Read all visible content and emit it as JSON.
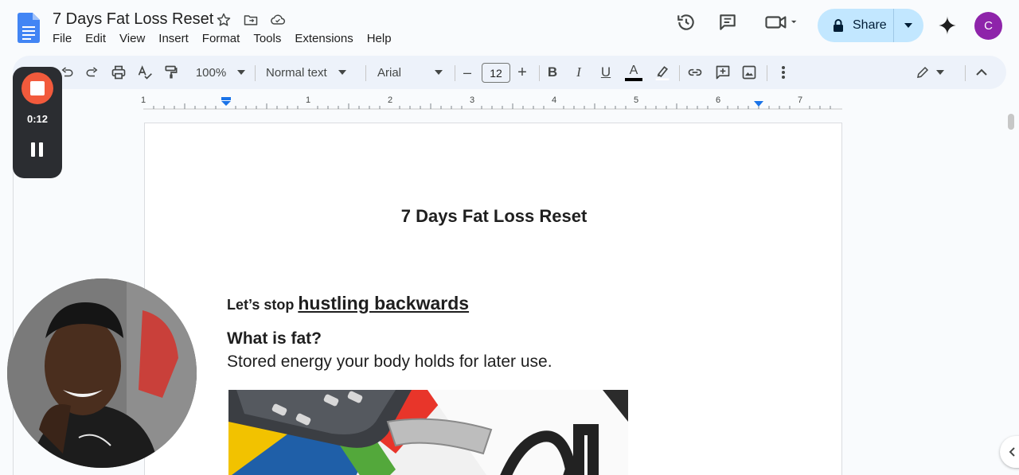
{
  "app": {
    "doc_title": "7 Days Fat Loss Reset",
    "menu": [
      "File",
      "Edit",
      "View",
      "Insert",
      "Format",
      "Tools",
      "Extensions",
      "Help"
    ],
    "share_label": "Share",
    "avatar_letter": "C"
  },
  "toolbar": {
    "zoom": "100%",
    "style": "Normal text",
    "font": "Arial",
    "font_size": "12",
    "minus": "–",
    "plus": "+",
    "bold": "B",
    "italic": "I",
    "underline": "U",
    "text_color_letter": "A"
  },
  "ruler": {
    "numbers": [
      "1",
      "1",
      "2",
      "3",
      "4",
      "5",
      "6",
      "7"
    ]
  },
  "document": {
    "heading": "7 Days Fat Loss Reset",
    "line1_prefix": "Let’s stop ",
    "line1_emphasis": "hustling backwards",
    "line2": "What is fat?",
    "line3": "Stored energy your body holds for later use."
  },
  "recorder": {
    "time": "0:12"
  },
  "colors": {
    "accent": "#c2e7ff",
    "record": "#f25a3c",
    "avatar": "#8e24aa"
  }
}
